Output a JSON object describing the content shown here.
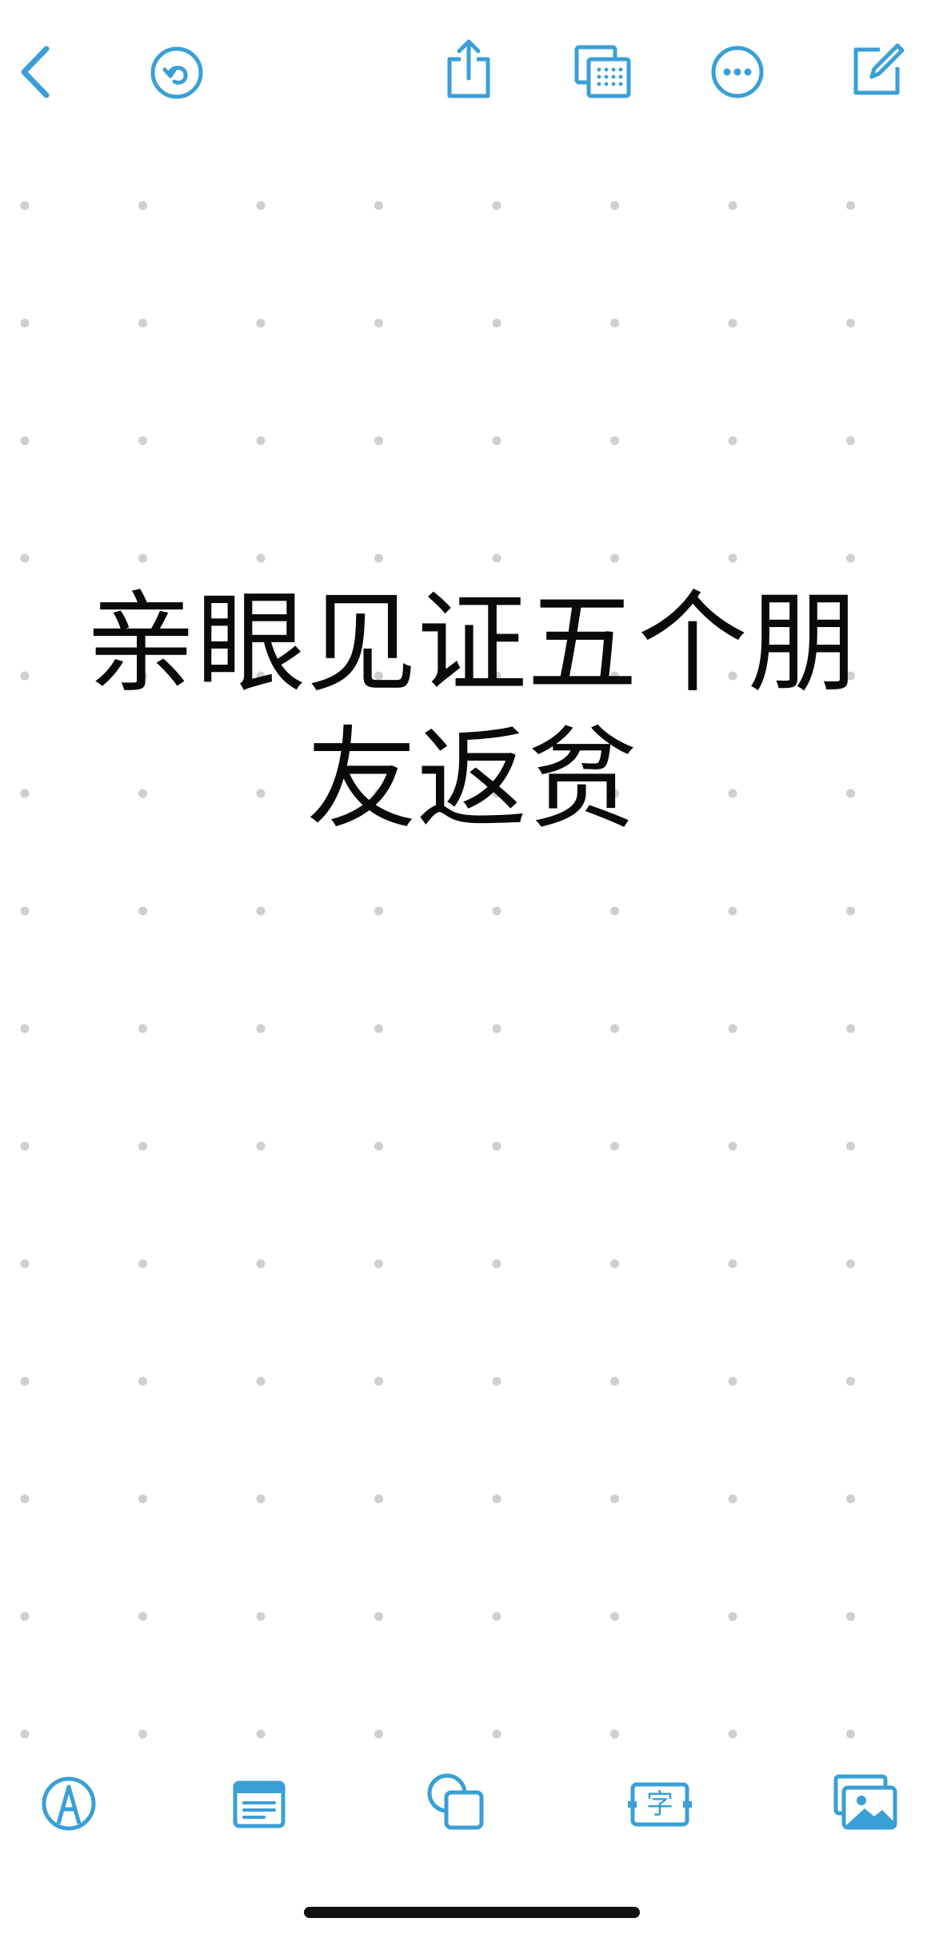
{
  "colors": {
    "accent": "#3a9fd6",
    "text": "#0a0a0a",
    "dot": "#cfcfcf",
    "background": "#ffffff"
  },
  "toolbar_top": {
    "back_icon": "chevron-left-icon",
    "undo_icon": "undo-icon",
    "share_icon": "share-icon",
    "board_icon": "board-view-icon",
    "more_icon": "more-icon",
    "new_icon": "compose-icon"
  },
  "note": {
    "text": "亲眼见证五个朋友返贫"
  },
  "toolbar_bottom": {
    "pen_icon": "pen-icon",
    "sticky_icon": "sticky-note-icon",
    "shapes_icon": "shapes-icon",
    "text_icon": "text-box-icon",
    "text_icon_glyph": "字",
    "media_icon": "photo-icon"
  }
}
